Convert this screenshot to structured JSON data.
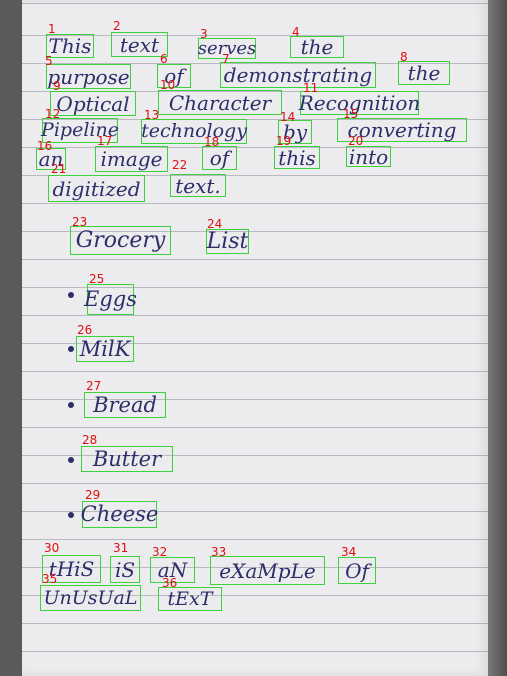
{
  "words": [
    {
      "id": "1",
      "text": "This"
    },
    {
      "id": "2",
      "text": "text"
    },
    {
      "id": "3",
      "text": "serves"
    },
    {
      "id": "4",
      "text": "the"
    },
    {
      "id": "5",
      "text": "purpose"
    },
    {
      "id": "6",
      "text": "of"
    },
    {
      "id": "7",
      "text": "demonstrating"
    },
    {
      "id": "8",
      "text": "the"
    },
    {
      "id": "9",
      "text": "Optical"
    },
    {
      "id": "10",
      "text": "Character"
    },
    {
      "id": "11",
      "text": "Recognition"
    },
    {
      "id": "12",
      "text": "Pipeline"
    },
    {
      "id": "13",
      "text": "technology"
    },
    {
      "id": "14",
      "text": "by"
    },
    {
      "id": "15",
      "text": "converting"
    },
    {
      "id": "16",
      "text": "an"
    },
    {
      "id": "17",
      "text": "image"
    },
    {
      "id": "18",
      "text": "of"
    },
    {
      "id": "19",
      "text": "this"
    },
    {
      "id": "20",
      "text": "into"
    },
    {
      "id": "21",
      "text": "digitized"
    },
    {
      "id": "22",
      "text": "text."
    },
    {
      "id": "23",
      "text": "Grocery"
    },
    {
      "id": "24",
      "text": "List"
    },
    {
      "id": "25",
      "text": "Eggs"
    },
    {
      "id": "26",
      "text": "MilK"
    },
    {
      "id": "27",
      "text": "Bread"
    },
    {
      "id": "28",
      "text": "Butter"
    },
    {
      "id": "29",
      "text": "Cheese"
    },
    {
      "id": "30",
      "text": "tHiS"
    },
    {
      "id": "31",
      "text": "iS"
    },
    {
      "id": "32",
      "text": "aN"
    },
    {
      "id": "33",
      "text": "eXaMpLe"
    },
    {
      "id": "34",
      "text": "Of"
    },
    {
      "id": "35",
      "text": "UnUsUaL"
    },
    {
      "id": "36",
      "text": "tExT"
    }
  ]
}
